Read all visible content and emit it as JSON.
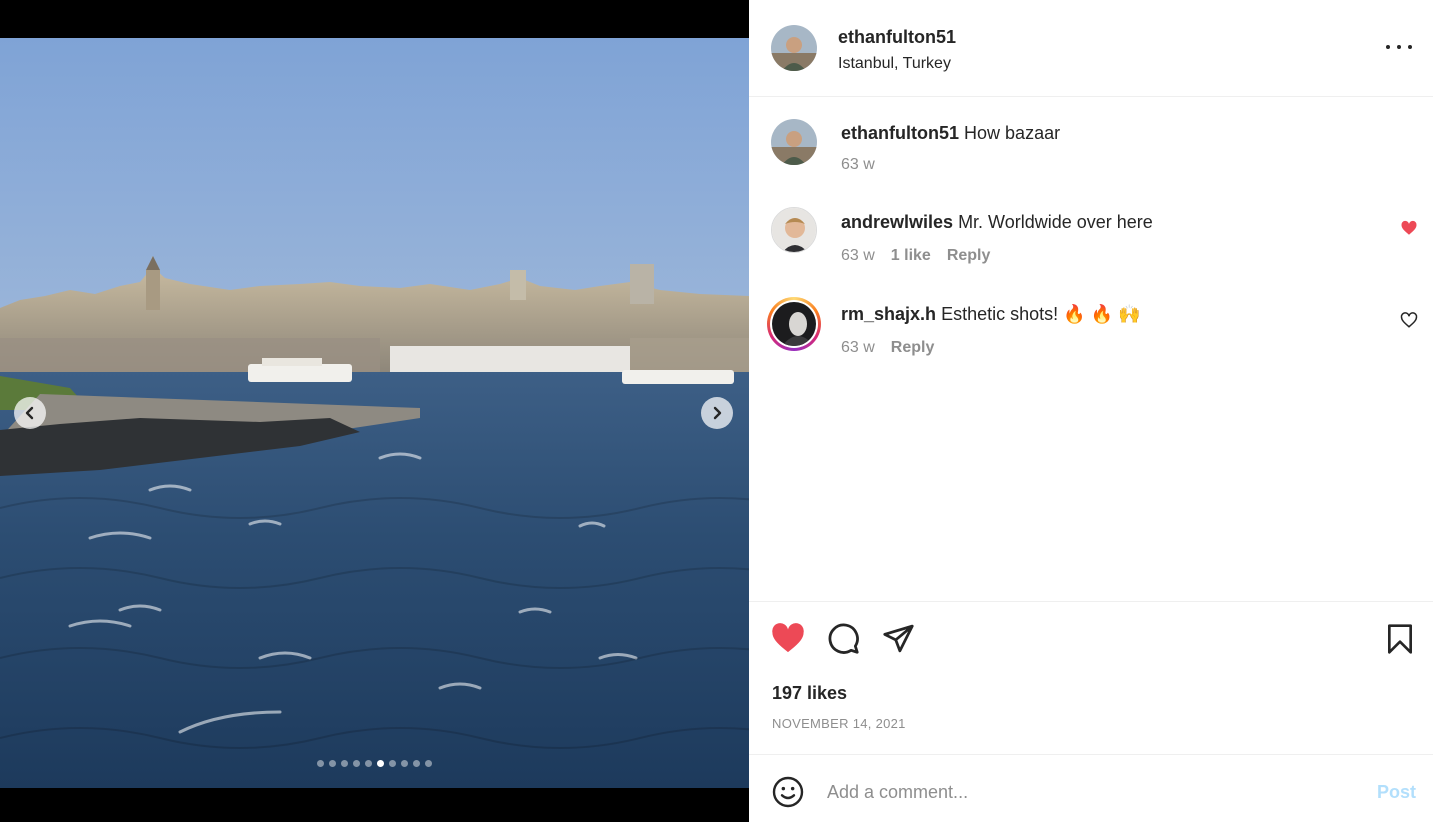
{
  "post": {
    "username": "ethanfulton51",
    "location": "Istanbul, Turkey",
    "caption": "How bazaar",
    "caption_age": "63 w",
    "likes": "197 likes",
    "date": "NOVEMBER 14, 2021",
    "liked": true,
    "carousel": {
      "count": 10,
      "active_index": 5
    }
  },
  "comments": [
    {
      "username": "andrewlwiles",
      "text": "Mr. Worldwide over here",
      "age": "63 w",
      "likes_label": "1 like",
      "reply_label": "Reply",
      "liked": true
    },
    {
      "username": "rm_shajx.h",
      "text": "Esthetic shots! 🔥 🔥 🙌",
      "age": "63 w",
      "reply_label": "Reply",
      "liked": false,
      "has_story": true
    }
  ],
  "composer": {
    "placeholder": "Add a comment...",
    "post_label": "Post"
  },
  "icons": {
    "more": "more-options-icon",
    "like": "heart-icon",
    "comment": "comment-icon",
    "share": "share-icon",
    "save": "bookmark-icon",
    "emoji": "emoji-icon",
    "prev": "chevron-left-icon",
    "next": "chevron-right-icon"
  },
  "colors": {
    "like_red": "#ed4956",
    "post_disabled": "#b2dffc",
    "muted_text": "#8e8e8e"
  }
}
